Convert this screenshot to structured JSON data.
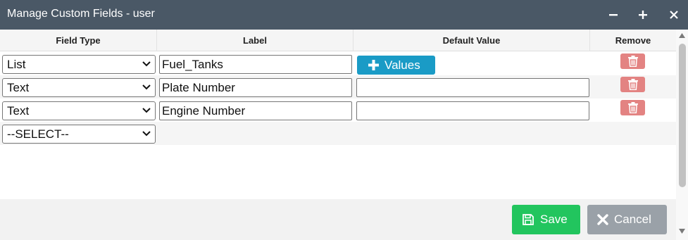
{
  "window": {
    "title": "Manage Custom Fields - user",
    "controls": [
      "minimize-icon",
      "maximize-icon",
      "close-icon"
    ]
  },
  "table": {
    "columns": [
      "Field Type",
      "Label",
      "Default Value",
      "Remove"
    ],
    "rows": [
      {
        "field_type": "List",
        "label": "Fuel_Tanks",
        "default_value_button": "Values"
      },
      {
        "field_type": "Text",
        "label": "Plate Number",
        "default_value": ""
      },
      {
        "field_type": "Text",
        "label": "Engine Number",
        "default_value": ""
      },
      {
        "field_type": "--SELECT--"
      }
    ]
  },
  "footer": {
    "save_label": "Save",
    "cancel_label": "Cancel"
  },
  "colors": {
    "titlebar": "#4a5866",
    "values_button": "#1a9bc6",
    "remove_button": "#e38382",
    "save_button": "#22c55e",
    "cancel_button": "#9aa1a8"
  }
}
